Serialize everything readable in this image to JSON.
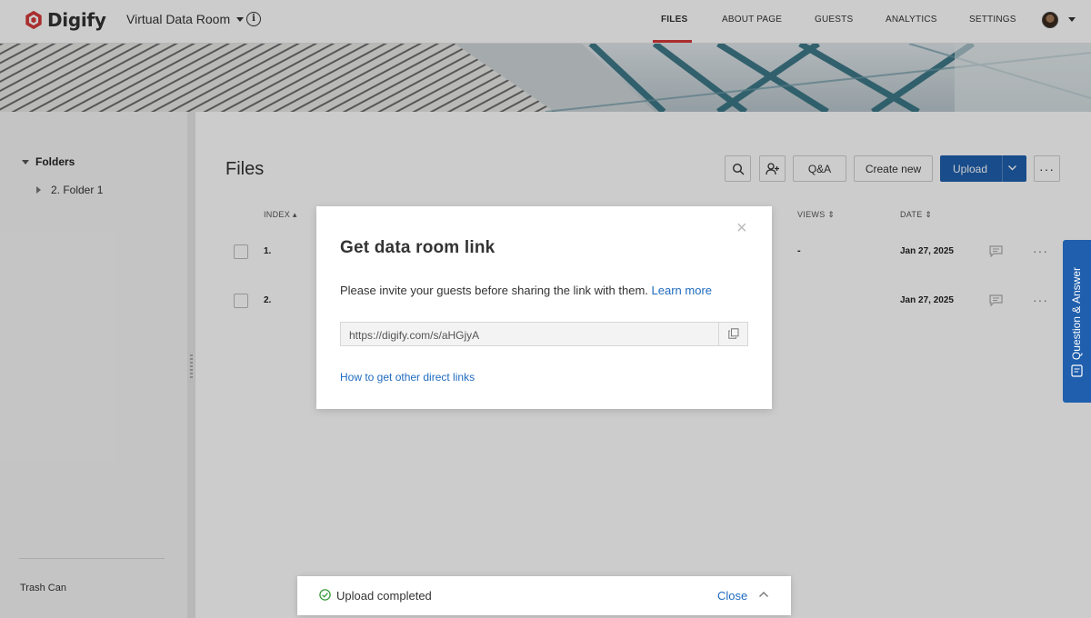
{
  "app": {
    "brand": "Digify",
    "room_name": "Virtual Data Room"
  },
  "nav": {
    "files": "FILES",
    "about": "ABOUT PAGE",
    "guests": "GUESTS",
    "analytics": "ANALYTICS",
    "settings": "SETTINGS",
    "active": "FILES",
    "accent_color": "#d43a3a"
  },
  "sidebar": {
    "folders_label": "Folders",
    "folder_items": [
      "2. Folder 1"
    ],
    "trash_label": "Trash Can"
  },
  "main": {
    "title": "Files",
    "toolbar": {
      "search_icon": "search-icon",
      "invite_icon": "add-user-icon",
      "qa_label": "Q&A",
      "create_label": "Create new",
      "upload_label": "Upload",
      "more_icon": "more-icon"
    },
    "columns": {
      "index": "INDEX",
      "views": "VIEWS",
      "date": "DATE"
    },
    "rows": [
      {
        "index": "1.",
        "views": "-",
        "date": "Jan 27, 2025"
      },
      {
        "index": "2.",
        "views": "",
        "date": "Jan 27, 2025"
      }
    ]
  },
  "qa_tab": {
    "label": "Question & Answer"
  },
  "modal": {
    "title": "Get data room link",
    "message": "Please invite your guests before sharing the link with them.",
    "learn_more": "Learn more",
    "link_value": "https://digify.com/s/aHGjyA",
    "other_links": "How to get other direct links",
    "close_icon": "×"
  },
  "toast": {
    "message": "Upload completed",
    "close_label": "Close"
  },
  "colors": {
    "primary": "#1f5fad",
    "link": "#1f6bbf",
    "success": "#3a9a3a"
  }
}
